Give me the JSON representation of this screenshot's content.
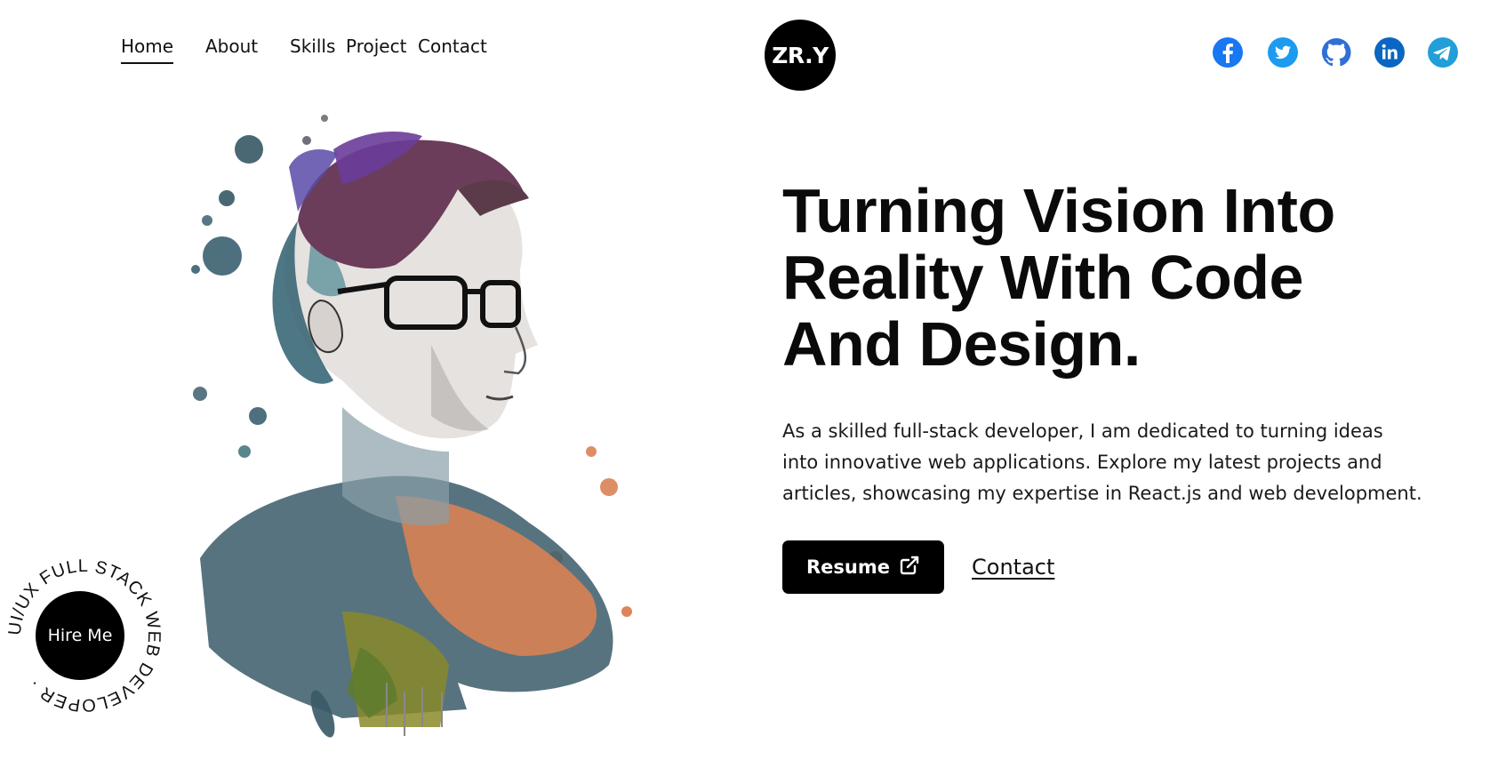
{
  "nav": {
    "items": [
      {
        "label": "Home",
        "active": true
      },
      {
        "label": "About",
        "active": false
      },
      {
        "label": "Skills",
        "active": false
      },
      {
        "label": "Project",
        "active": false
      },
      {
        "label": "Contact",
        "active": false
      }
    ]
  },
  "logo": {
    "text": "ZR.Y"
  },
  "social": {
    "icons": [
      "facebook-icon",
      "twitter-icon",
      "github-icon",
      "linkedin-icon",
      "telegram-icon"
    ],
    "color": "#1877f2"
  },
  "hero": {
    "headline_lines": [
      "Turning Vision Into",
      "Reality With Code",
      "And Design."
    ],
    "description": "As a skilled full-stack developer, I am dedicated to turning ideas into innovative web applications. Explore my latest projects and articles, showcasing my expertise in React.js and web development.",
    "resume_label": "Resume",
    "contact_label": "Contact"
  },
  "hire": {
    "button_label": "Hire Me",
    "ring_text": "UI/UX FULL STACK WEB DEVELOPER · "
  },
  "colors": {
    "background": "#ffffff",
    "text": "#000000",
    "button": "#000000",
    "button_text": "#ffffff"
  }
}
